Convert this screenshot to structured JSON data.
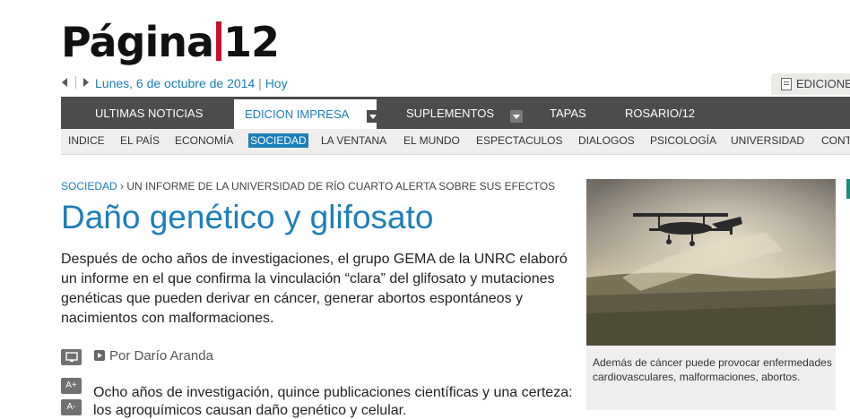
{
  "logo": {
    "part1": "Página",
    "part2": "12"
  },
  "dateline": {
    "date": "Lunes, 6 de octubre de 2014",
    "separator": "|",
    "today": "Hoy"
  },
  "edition_tab": {
    "label": "EDICIONE"
  },
  "main_nav": [
    {
      "label": "ULTIMAS NOTICIAS"
    },
    {
      "label": "EDICION IMPRESA"
    },
    {
      "label": "SUPLEMENTOS"
    },
    {
      "label": "TAPAS"
    },
    {
      "label": "ROSARIO/12"
    }
  ],
  "sub_nav": [
    {
      "label": "INDICE"
    },
    {
      "label": "EL PAÍS"
    },
    {
      "label": "ECONOMÍA"
    },
    {
      "label": "SOCIEDAD"
    },
    {
      "label": "LA VENTANA"
    },
    {
      "label": "EL MUNDO"
    },
    {
      "label": "ESPECTACULOS"
    },
    {
      "label": "DIALOGOS"
    },
    {
      "label": "PSICOLOGÍA"
    },
    {
      "label": "UNIVERSIDAD"
    },
    {
      "label": "CONT"
    }
  ],
  "article": {
    "section": "SOCIEDAD",
    "crumb_sep": "›",
    "kicker": "UN INFORME DE LA UNIVERSIDAD DE RÍO CUARTO ALERTA SOBRE SUS EFECTOS",
    "title": "Daño genético y glifosato",
    "lead": "Después de ocho años de investigaciones, el grupo GEMA de la UNRC elaboró un informe en el que confirma la vinculación “clara” del glifosato y mutaciones genéticas que pueden derivar en cáncer, generar abortos espontáneos y nacimientos con malformaciones.",
    "byline": "Por Darío Aranda",
    "body_line1": "Ocho años de investigación, quince publicaciones científicas y una certeza:",
    "body_line2": "los agroquímicos causan daño genético y celular.",
    "tools": {
      "font_up": "A+",
      "font_down": "A-"
    }
  },
  "photo": {
    "caption": "Además de cáncer puede provocar enfermedades cardiovasculares, malformaciones, abortos."
  },
  "icons": {
    "nav_left": "arrow-left-icon",
    "nav_right": "arrow-right-icon",
    "edition": "newspaper-icon",
    "dropdown": "chevron-down-icon",
    "print": "monitor-icon",
    "byline": "play-arrow-icon"
  },
  "colors": {
    "accent": "#1b7fb8",
    "nav_bg": "#4b4c4e",
    "logo_red": "#c8102e"
  }
}
